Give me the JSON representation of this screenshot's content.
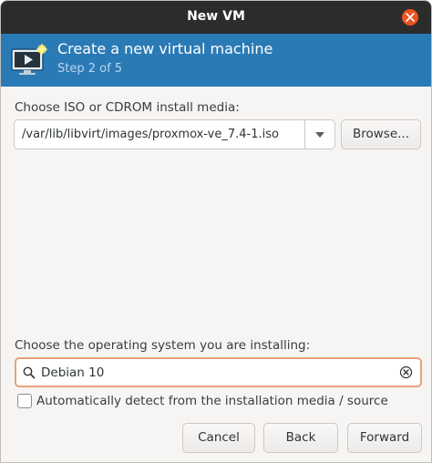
{
  "window": {
    "title": "New VM"
  },
  "header": {
    "title": "Create a new virtual machine",
    "step": "Step 2 of 5"
  },
  "iso": {
    "label": "Choose ISO or CDROM install media:",
    "path": "/var/lib/libvirt/images/proxmox-ve_7.4-1.iso",
    "browse_label": "Browse..."
  },
  "os": {
    "label": "Choose the operating system you are installing:",
    "search_value": "Debian 10",
    "auto_detect_label": "Automatically detect from the installation media / source",
    "auto_detect_checked": false
  },
  "footer": {
    "cancel_label": "Cancel",
    "back_label": "Back",
    "forward_label": "Forward"
  },
  "colors": {
    "titlebar": "#2c2c2c",
    "header": "#2a7ab5",
    "close_button": "#e95420",
    "search_focus_border": "#e8a07a"
  }
}
